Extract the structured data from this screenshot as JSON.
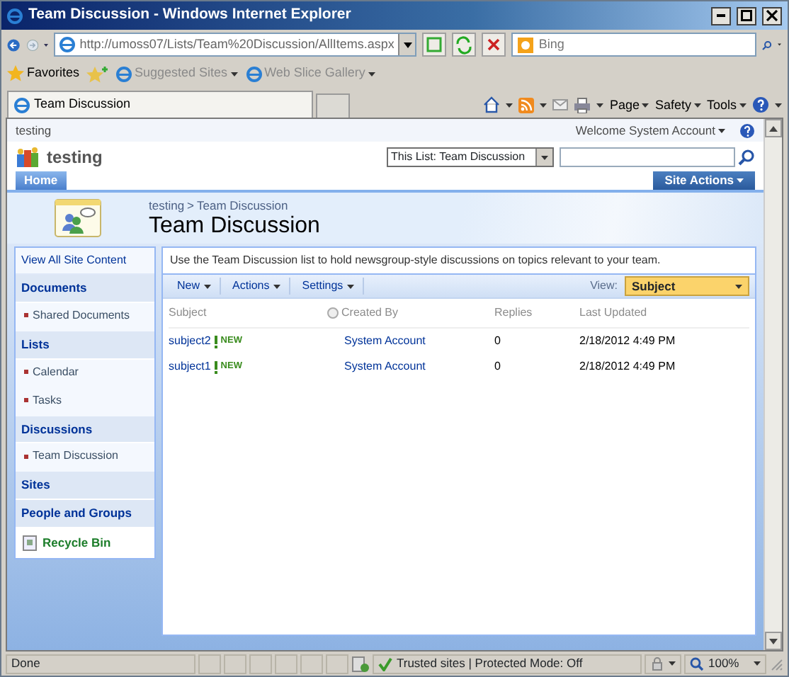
{
  "window": {
    "title": "Team Discussion - Windows Internet Explorer"
  },
  "address_bar": {
    "url": "http://umoss07/Lists/Team%20Discussion/AllItems.aspx",
    "search_placeholder": "Bing"
  },
  "favorites_bar": {
    "label": "Favorites",
    "links": [
      "Suggested Sites",
      "Web Slice Gallery"
    ]
  },
  "tabs": [
    {
      "label": "Team Discussion",
      "selected": true
    }
  ],
  "command_bar": [
    "Page",
    "Safety",
    "Tools"
  ],
  "site": {
    "top_link": "testing",
    "welcome": "Welcome System Account",
    "title": "testing",
    "search_scope": "This List: Team Discussion",
    "nav_tabs": [
      {
        "label": "Home",
        "selected": true
      }
    ],
    "site_actions": "Site Actions"
  },
  "page": {
    "breadcrumb": [
      "testing",
      "Team Discussion"
    ],
    "breadcrumb_separator": ">",
    "title": "Team Discussion"
  },
  "quick_launch": [
    {
      "kind": "link",
      "label": "View All Site Content"
    },
    {
      "kind": "heading",
      "label": "Documents"
    },
    {
      "kind": "sub",
      "label": "Shared Documents"
    },
    {
      "kind": "heading",
      "label": "Lists"
    },
    {
      "kind": "sub",
      "label": "Calendar"
    },
    {
      "kind": "sub",
      "label": "Tasks"
    },
    {
      "kind": "heading",
      "label": "Discussions"
    },
    {
      "kind": "sub",
      "label": "Team Discussion"
    },
    {
      "kind": "heading",
      "label": "Sites"
    },
    {
      "kind": "heading",
      "label": "People and Groups"
    },
    {
      "kind": "recycle",
      "label": "Recycle Bin"
    }
  ],
  "list": {
    "description": "Use the Team Discussion list to hold newsgroup-style discussions on topics relevant to your team.",
    "toolbar": [
      "New",
      "Actions",
      "Settings"
    ],
    "view_label": "View:",
    "view": "Subject",
    "columns": [
      "Subject",
      "Created By",
      "Replies",
      "Last Updated"
    ],
    "rows": [
      {
        "subject": "subject2",
        "tag": "NEW",
        "created_by": "System Account",
        "replies": "0",
        "last_updated": "2/18/2012 4:49 PM"
      },
      {
        "subject": "subject1",
        "tag": "NEW",
        "created_by": "System Account",
        "replies": "0",
        "last_updated": "2/18/2012 4:49 PM"
      }
    ]
  },
  "status_bar": {
    "text": "Done",
    "zone": "Trusted sites | Protected Mode: Off",
    "zoom": "100%"
  }
}
